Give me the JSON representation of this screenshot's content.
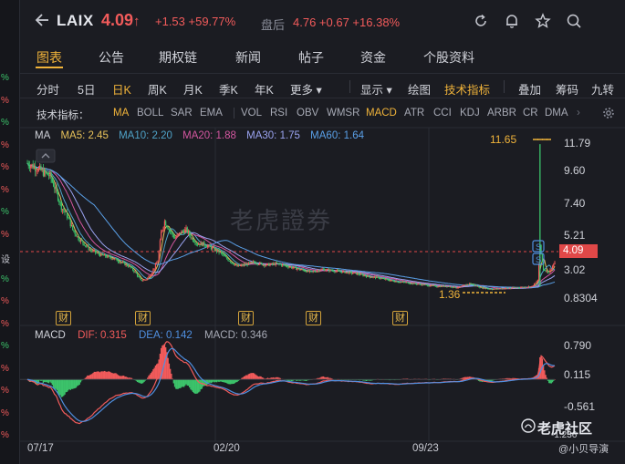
{
  "left_strip": {
    "items": [
      {
        "text": "%",
        "color": "#3cc46b"
      },
      {
        "text": "%",
        "color": "#f25b5b"
      },
      {
        "text": "%",
        "color": "#3cc46b"
      },
      {
        "text": "%",
        "color": "#f25b5b"
      },
      {
        "text": "%",
        "color": "#f25b5b"
      },
      {
        "text": "%",
        "color": "#f25b5b"
      },
      {
        "text": "%",
        "color": "#3cc46b"
      },
      {
        "text": "%",
        "color": "#f25b5b"
      },
      {
        "text": "设",
        "color": "#c8cad2"
      },
      {
        "text": "%",
        "color": "#3cc46b"
      },
      {
        "text": "%",
        "color": "#f25b5b"
      },
      {
        "text": "%",
        "color": "#f25b5b"
      },
      {
        "text": "%",
        "color": "#3cc46b"
      },
      {
        "text": "%",
        "color": "#f25b5b"
      },
      {
        "text": "%",
        "color": "#f25b5b"
      },
      {
        "text": "%",
        "color": "#f25b5b"
      },
      {
        "text": "%",
        "color": "#f25b5b"
      }
    ]
  },
  "header": {
    "symbol": "LAIX",
    "price": "4.09",
    "price_arrow": "↑",
    "change": "+1.53  +59.77%",
    "after_hours_label": "盘后",
    "after_hours": "4.76  +0.67  +16.38%",
    "icons": [
      "refresh-icon",
      "bell-icon",
      "star-icon",
      "search-icon"
    ]
  },
  "tabs": [
    {
      "label": "图表",
      "active": true
    },
    {
      "label": "公告",
      "active": false
    },
    {
      "label": "期权链",
      "active": false
    },
    {
      "label": "新闻",
      "active": false
    },
    {
      "label": "帖子",
      "active": false
    },
    {
      "label": "资金",
      "active": false
    },
    {
      "label": "个股资料",
      "active": false
    }
  ],
  "periods": [
    {
      "label": "分时",
      "active": false
    },
    {
      "label": "5日",
      "active": false
    },
    {
      "label": "日K",
      "active": true
    },
    {
      "label": "周K",
      "active": false
    },
    {
      "label": "月K",
      "active": false
    },
    {
      "label": "季K",
      "active": false
    },
    {
      "label": "年K",
      "active": false
    },
    {
      "label": "更多 ▾",
      "active": false
    }
  ],
  "tools": [
    {
      "label": "显示 ▾",
      "active": false
    },
    {
      "label": "绘图",
      "active": false
    },
    {
      "label": "技术指标",
      "active": true
    },
    {
      "label": "叠加",
      "active": false
    },
    {
      "label": "筹码",
      "active": false
    },
    {
      "label": "九转",
      "active": false
    }
  ],
  "indicators": {
    "label": "技术指标：",
    "items": [
      {
        "label": "MA",
        "active": true
      },
      {
        "label": "BOLL",
        "active": false
      },
      {
        "label": "SAR",
        "active": false
      },
      {
        "label": "EMA",
        "active": false
      },
      {
        "label": "VOL",
        "active": false
      },
      {
        "label": "RSI",
        "active": false
      },
      {
        "label": "OBV",
        "active": false
      },
      {
        "label": "WMSR",
        "active": false
      },
      {
        "label": "MACD",
        "active": true
      },
      {
        "label": "ATR",
        "active": false
      },
      {
        "label": "CCI",
        "active": false
      },
      {
        "label": "KDJ",
        "active": false
      },
      {
        "label": "ARBR",
        "active": false
      },
      {
        "label": "CR",
        "active": false
      },
      {
        "label": "DMA",
        "active": false
      }
    ]
  },
  "ma_legend": [
    {
      "text": "MA",
      "color": "#d0d2d9"
    },
    {
      "text": "MA5: 2.45",
      "color": "#e8c25a"
    },
    {
      "text": "MA10: 2.20",
      "color": "#4fa3c8"
    },
    {
      "text": "MA20: 1.88",
      "color": "#d457a0"
    },
    {
      "text": "MA30: 1.75",
      "color": "#9aa3f0"
    },
    {
      "text": "MA60: 1.64",
      "color": "#5aa0e8"
    }
  ],
  "macd_legend": [
    {
      "text": "MACD",
      "color": "#d0d2d9"
    },
    {
      "text": "DIF: 0.315",
      "color": "#f25b5b"
    },
    {
      "text": "DEA: 0.142",
      "color": "#4f8fe0"
    },
    {
      "text": "MACD: 0.346",
      "color": "#a6a9b4"
    }
  ],
  "price_axis": [
    "11.79",
    "9.60",
    "7.40",
    "5.21",
    "3.02",
    "0.8304"
  ],
  "macd_axis": [
    "0.790",
    "0.115",
    "-0.561",
    "-1.236"
  ],
  "last_price_tag": "4.09",
  "high_marker": "11.65",
  "low_marker": "1.36",
  "x_labels": [
    "07/17",
    "02/20",
    "09/23"
  ],
  "financial_badge": "财",
  "watermark": "老虎證券",
  "brand": "老虎社区",
  "brand_sub": "@小贝导演",
  "colors": {
    "up": "#f25b5b",
    "down": "#3cc46b",
    "accent": "#f0b33a"
  },
  "chart_data": {
    "type": "candlestick",
    "title": "",
    "price_range": [
      0.8304,
      11.79
    ],
    "last_price": 4.09,
    "high": 11.65,
    "low": 1.36,
    "x_ticks": [
      "07/17",
      "02/20",
      "09/23"
    ],
    "close_path": [
      [
        0,
        10.3
      ],
      [
        5,
        10.1
      ],
      [
        10,
        9.9
      ],
      [
        15,
        9.6
      ],
      [
        20,
        9.4
      ],
      [
        25,
        8.4
      ],
      [
        30,
        7.2
      ],
      [
        35,
        6.6
      ],
      [
        40,
        5.6
      ],
      [
        45,
        5.0
      ],
      [
        50,
        4.6
      ],
      [
        55,
        4.2
      ],
      [
        60,
        4.0
      ],
      [
        65,
        3.8
      ],
      [
        70,
        3.7
      ],
      [
        75,
        3.6
      ],
      [
        80,
        3.4
      ],
      [
        85,
        3.2
      ],
      [
        90,
        3.0
      ],
      [
        95,
        2.6
      ],
      [
        100,
        2.0
      ],
      [
        105,
        2.1
      ],
      [
        110,
        2.6
      ],
      [
        115,
        3.4
      ],
      [
        118,
        5.4
      ],
      [
        121,
        6.2
      ],
      [
        125,
        5.6
      ],
      [
        130,
        5.0
      ],
      [
        135,
        5.4
      ],
      [
        140,
        5.6
      ],
      [
        145,
        5.0
      ],
      [
        150,
        4.6
      ],
      [
        155,
        4.6
      ],
      [
        160,
        4.4
      ],
      [
        165,
        4.2
      ],
      [
        170,
        4.0
      ],
      [
        175,
        3.6
      ],
      [
        180,
        3.3
      ],
      [
        185,
        3.0
      ],
      [
        190,
        3.1
      ],
      [
        195,
        3.2
      ],
      [
        200,
        3.3
      ],
      [
        210,
        3.1
      ],
      [
        220,
        3.2
      ],
      [
        230,
        3.0
      ],
      [
        240,
        2.8
      ],
      [
        250,
        2.6
      ],
      [
        260,
        2.8
      ],
      [
        270,
        2.7
      ],
      [
        280,
        2.6
      ],
      [
        290,
        2.5
      ],
      [
        300,
        2.3
      ],
      [
        310,
        2.2
      ],
      [
        320,
        2.0
      ],
      [
        330,
        1.9
      ],
      [
        340,
        1.8
      ],
      [
        350,
        1.7
      ],
      [
        360,
        1.6
      ],
      [
        370,
        1.6
      ],
      [
        380,
        1.5
      ],
      [
        390,
        1.8
      ],
      [
        400,
        1.5
      ],
      [
        410,
        1.4
      ],
      [
        420,
        1.45
      ],
      [
        430,
        1.5
      ],
      [
        440,
        1.55
      ],
      [
        445,
        1.6
      ],
      [
        450,
        2.0
      ],
      [
        452,
        4.4
      ],
      [
        455,
        2.8
      ],
      [
        460,
        2.6
      ],
      [
        465,
        3.3
      ]
    ],
    "macd_range": [
      -1.236,
      0.79
    ],
    "macd_dif": 0.315,
    "macd_dea": 0.142,
    "macd_hist": 0.346
  }
}
